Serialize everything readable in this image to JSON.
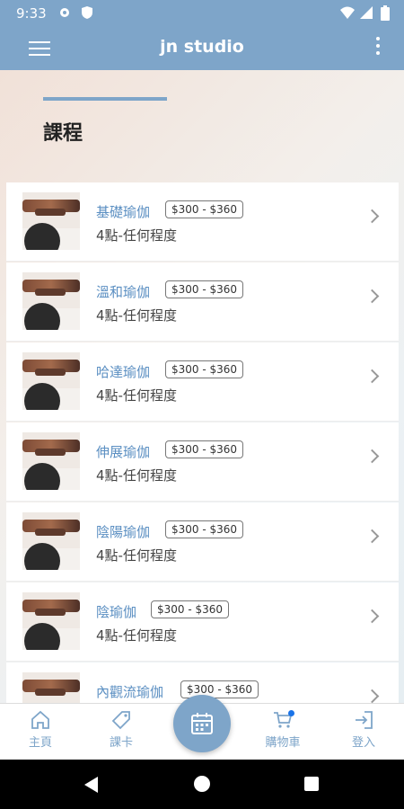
{
  "status_bar": {
    "time": "9:33"
  },
  "app_bar": {
    "title": "jn studio"
  },
  "page": {
    "title": "課程"
  },
  "courses": [
    {
      "name": "基礎瑜伽",
      "price": "$300 - $360",
      "subtitle": "4點-任何程度"
    },
    {
      "name": "溫和瑜伽",
      "price": "$300 - $360",
      "subtitle": "4點-任何程度"
    },
    {
      "name": "哈達瑜伽",
      "price": "$300 - $360",
      "subtitle": "4點-任何程度"
    },
    {
      "name": "伸展瑜伽",
      "price": "$300 - $360",
      "subtitle": "4點-任何程度"
    },
    {
      "name": "陰陽瑜伽",
      "price": "$300 - $360",
      "subtitle": "4點-任何程度"
    },
    {
      "name": "陰瑜伽",
      "price": "$300 - $360",
      "subtitle": "4點-任何程度"
    },
    {
      "name": "內觀流瑜伽",
      "price": "$300 - $360",
      "subtitle": ""
    }
  ],
  "bottom_nav": {
    "home": "主頁",
    "class_card": "課卡",
    "cart": "購物車",
    "login": "登入"
  },
  "colors": {
    "primary": "#7ea5c9",
    "link": "#5b8fc2"
  }
}
